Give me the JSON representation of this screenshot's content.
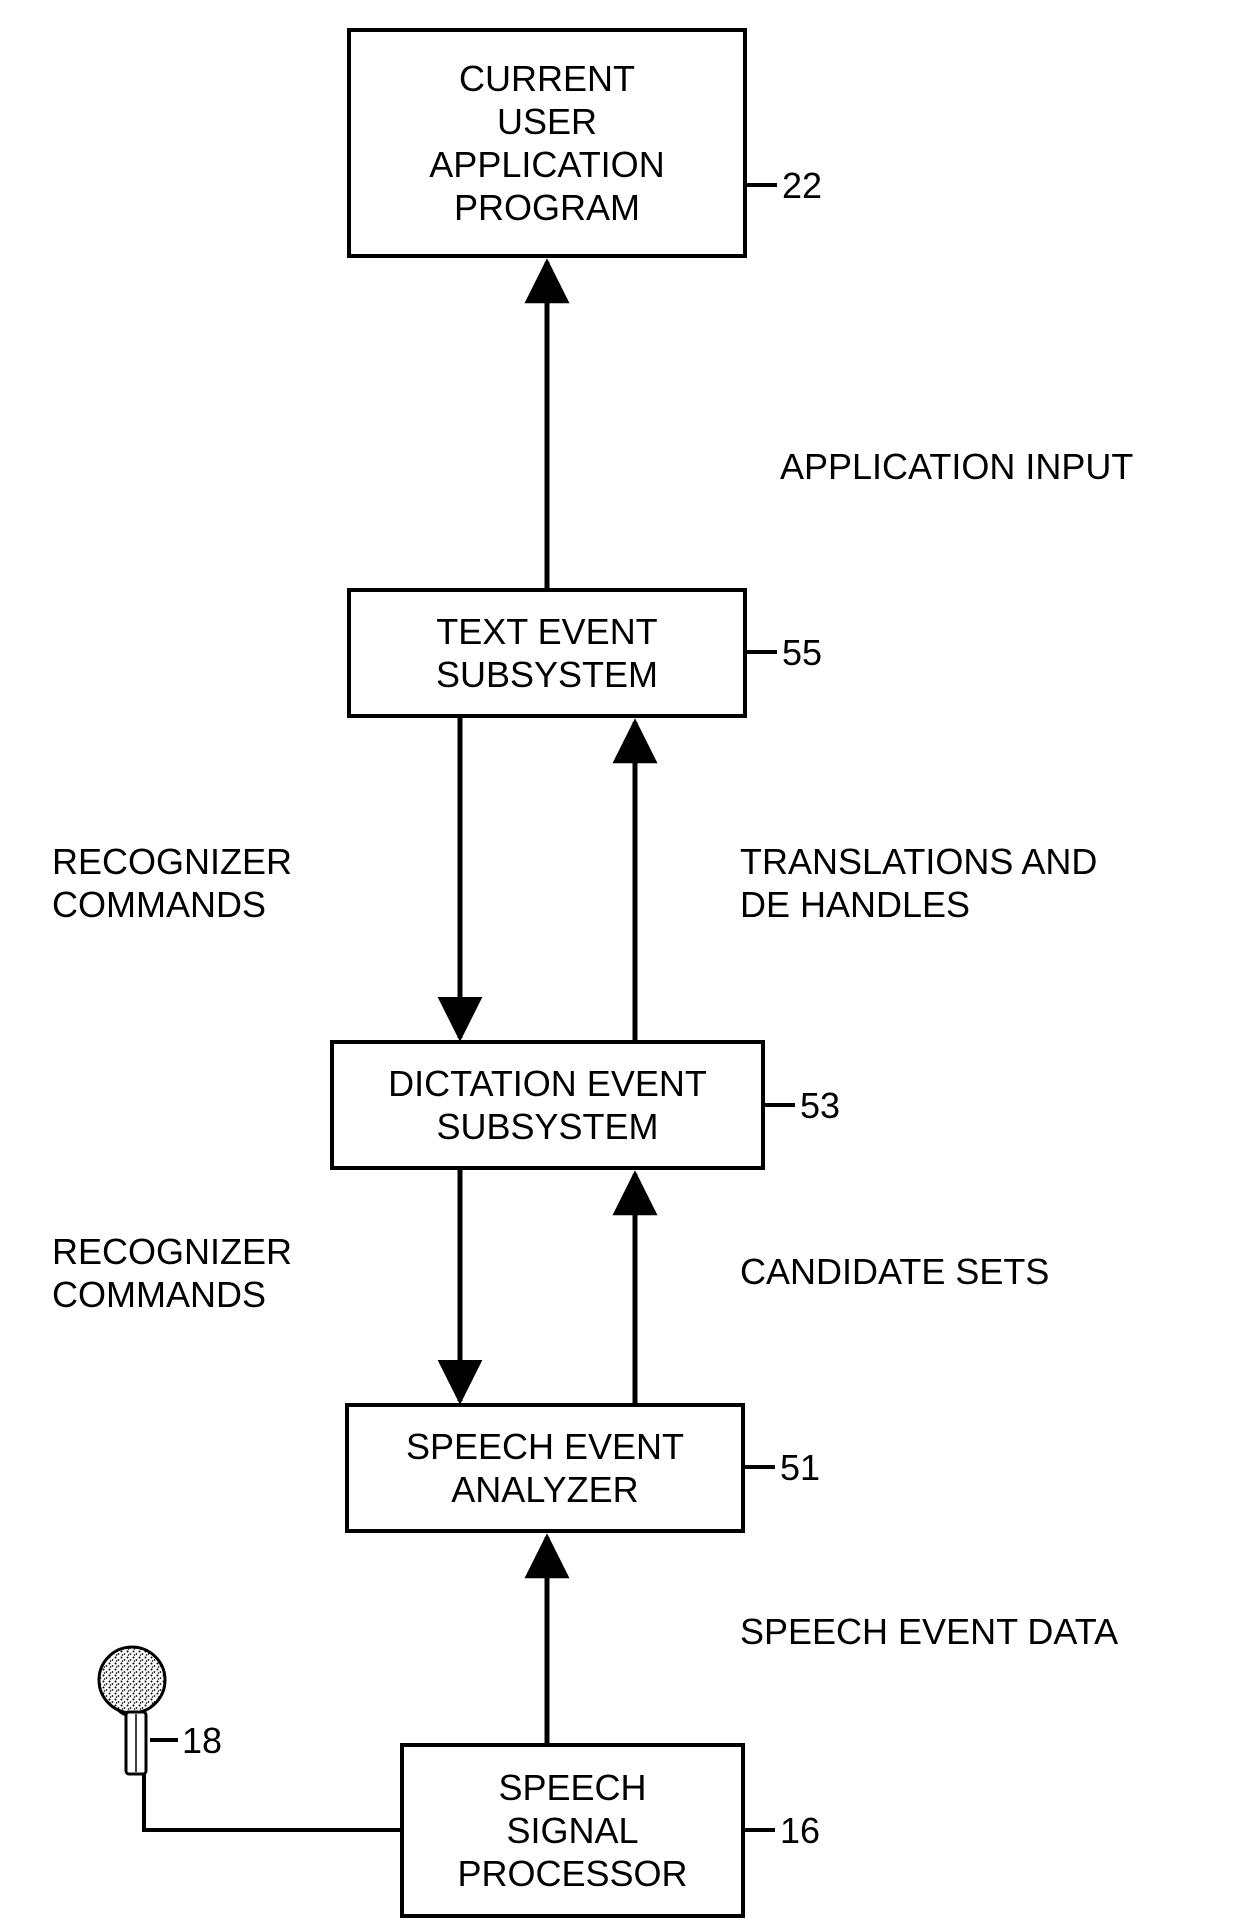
{
  "boxes": {
    "app": {
      "text": "CURRENT\nUSER\nAPPLICATION\nPROGRAM",
      "ref": "22"
    },
    "textsub": {
      "text": "TEXT EVENT\nSUBSYSTEM",
      "ref": "55"
    },
    "dictsub": {
      "text": "DICTATION EVENT\nSUBSYSTEM",
      "ref": "53"
    },
    "analyzer": {
      "text": "SPEECH EVENT\nANALYZER",
      "ref": "51"
    },
    "ssp": {
      "text": "SPEECH\nSIGNAL\nPROCESSOR",
      "ref": "16"
    }
  },
  "labels": {
    "appInput": "APPLICATION INPUT",
    "recognizerCmds1": "RECOGNIZER\nCOMMANDS",
    "translations": "TRANSLATIONS AND\nDE HANDLES",
    "recognizerCmds2": "RECOGNIZER\nCOMMANDS",
    "candidateSets": "CANDIDATE SETS",
    "speechEventData": "SPEECH EVENT DATA"
  },
  "mic": {
    "ref": "18"
  }
}
